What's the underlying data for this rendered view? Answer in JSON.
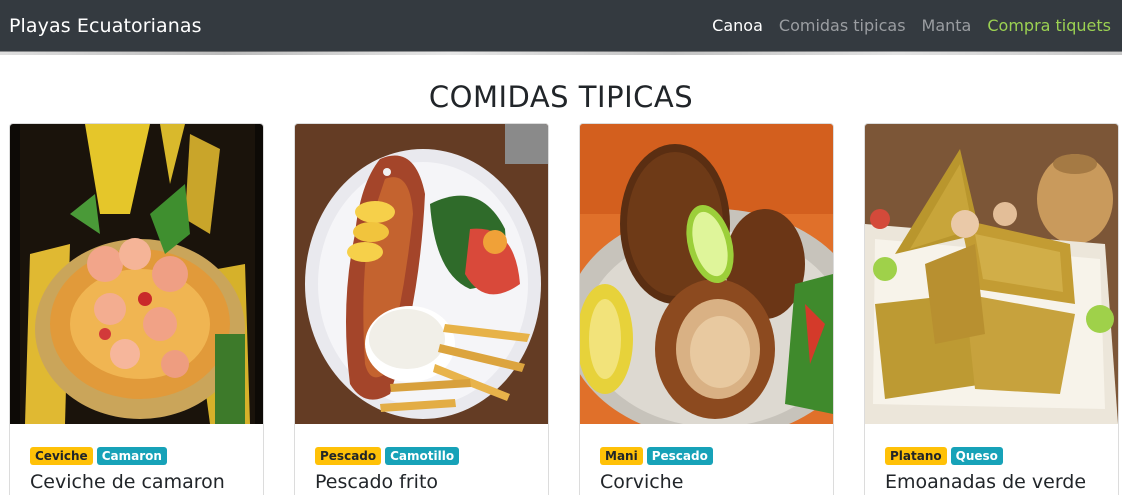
{
  "navbar": {
    "brand": "Playas Ecuatorianas",
    "links": [
      {
        "label": "Canoa"
      },
      {
        "label": "Comidas tipicas"
      },
      {
        "label": "Manta"
      },
      {
        "label": "Compra tiquets"
      }
    ]
  },
  "section": {
    "title": "COMIDAS TIPICAS"
  },
  "cards": [
    {
      "tags": [
        "Ceviche",
        "Camaron"
      ],
      "title": "Ceviche de camaron"
    },
    {
      "tags": [
        "Pescado",
        "Camotillo"
      ],
      "title": "Pescado frito"
    },
    {
      "tags": [
        "Mani",
        "Pescado"
      ],
      "title": "Corviche"
    },
    {
      "tags": [
        "Platano",
        "Queso"
      ],
      "title": "Emoanadas de verde"
    }
  ],
  "colors": {
    "navbar_bg": "#343a40",
    "badge_yellow": "#ffc107",
    "badge_teal": "#17a2b8",
    "cta_link": "#9bd152"
  }
}
